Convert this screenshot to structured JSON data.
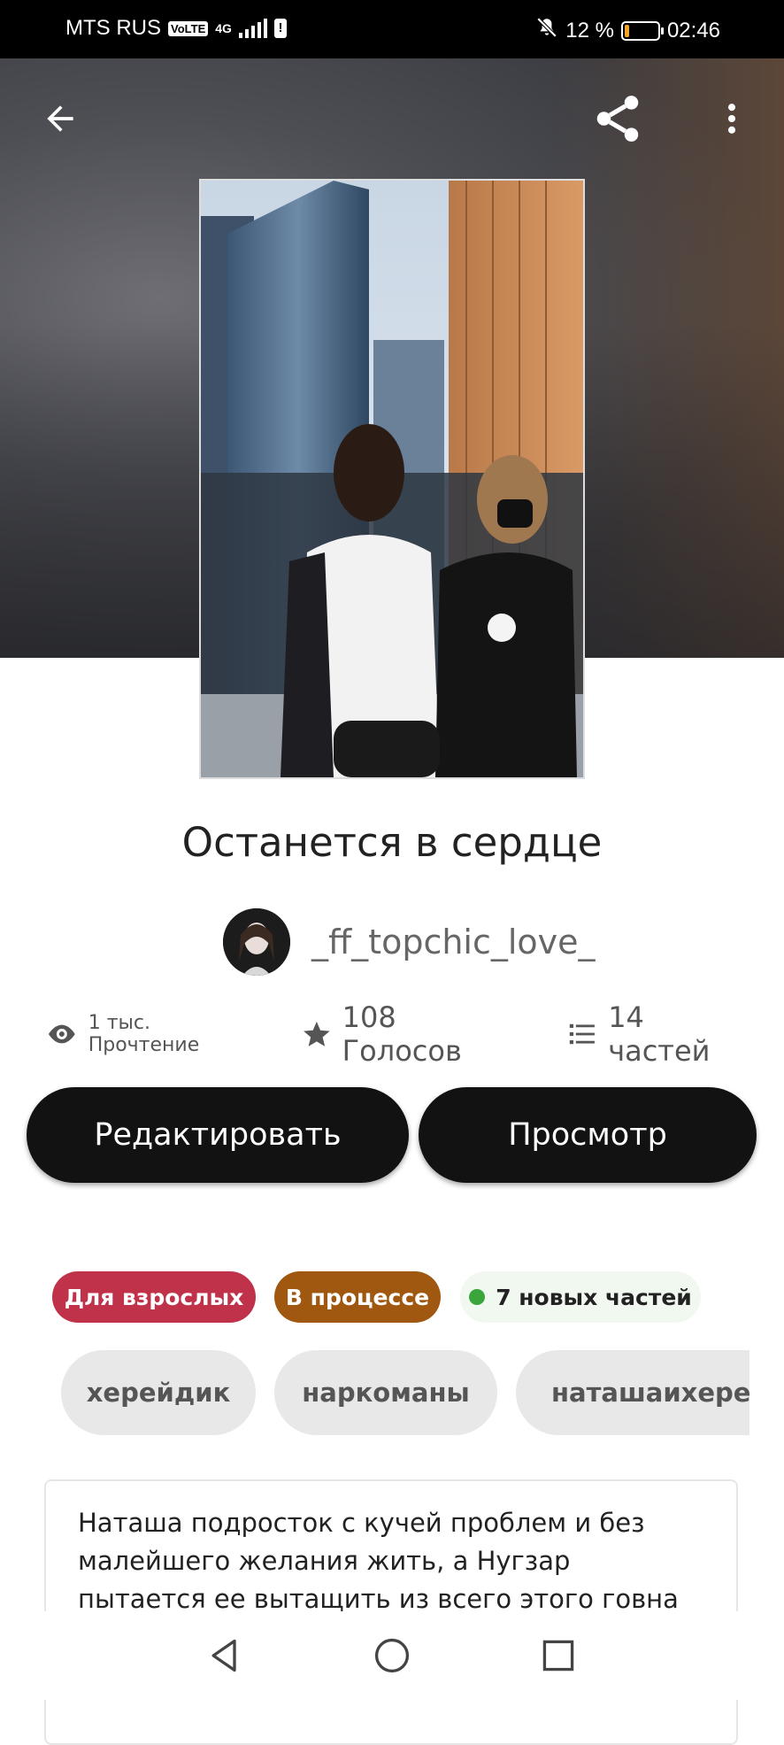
{
  "status_bar": {
    "carrier": "MTS RUS",
    "volte": "VoLTE",
    "network": "4G",
    "battery_percent": "12 %",
    "time": "02:46"
  },
  "toolbar": {
    "back_icon": "arrow-left-icon",
    "share_icon": "share-icon",
    "more_icon": "more-vertical-icon"
  },
  "story": {
    "title": "Останется в сердце",
    "author": "_ff_topchic_love_",
    "description": "Наташа подросток  с кучей проблем и без малейшего желания жить, а Нугзар пытается ее вытащить из всего этого говна"
  },
  "stats": {
    "reads": "1 тыс. Прочтение",
    "votes": "108 Голосов",
    "parts": "14 частей"
  },
  "actions": {
    "edit": "Редактировать",
    "view": "Просмотр"
  },
  "badges": {
    "mature": "Для взрослых",
    "ongoing": "В процессе",
    "new_parts": "7 новых частей"
  },
  "tags": [
    "херейдик",
    "наркоманы",
    "наташаихерейдик"
  ],
  "colors": {
    "mature": "#c0324a",
    "ongoing": "#a0570f",
    "new_parts_bg": "#f1f8ef",
    "new_parts_dot": "#3aa53a",
    "button": "#121212"
  },
  "system_nav": {
    "back": "triangle-back-icon",
    "home": "circle-home-icon",
    "recents": "square-recents-icon"
  }
}
